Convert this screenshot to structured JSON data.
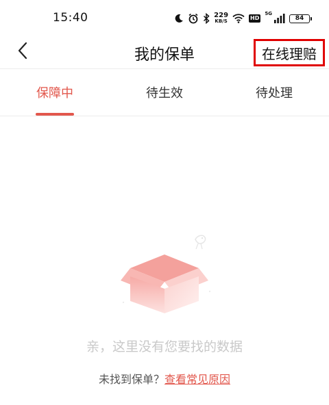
{
  "status_bar": {
    "time": "15:40",
    "net_speed_value": "229",
    "net_speed_unit": "KB/S",
    "hd_label": "HD",
    "signal_label": "5G",
    "battery": "84",
    "icons": [
      "moon-icon",
      "alarm-icon",
      "bluetooth-icon",
      "wifi-icon",
      "signal-icon",
      "battery-icon"
    ]
  },
  "header": {
    "title": "我的保单",
    "back_icon": "chevron-left-icon",
    "online_claim_label": "在线理赔"
  },
  "tabs": [
    {
      "label": "保障中",
      "active": true
    },
    {
      "label": "待生效",
      "active": false
    },
    {
      "label": "待处理",
      "active": false
    }
  ],
  "empty_state": {
    "illustration": "open-box-icon",
    "message": "亲，这里没有您要找的数据",
    "hint_prefix": "未找到保单？",
    "hint_link": "查看常见原因"
  },
  "colors": {
    "accent": "#e2574c",
    "highlight_box": "#e00000",
    "empty_text": "#c9c9c9"
  }
}
